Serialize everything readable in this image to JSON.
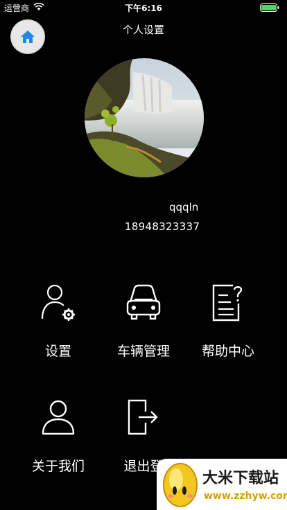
{
  "status_bar": {
    "carrier": "运营商",
    "time": "下午6:16"
  },
  "nav": {
    "title": "个人设置"
  },
  "profile": {
    "username": "qqqln",
    "phone": "18948323337"
  },
  "menu": [
    {
      "label": "设置",
      "icon": "user-settings-icon"
    },
    {
      "label": "车辆管理",
      "icon": "car-icon"
    },
    {
      "label": "帮助中心",
      "icon": "help-document-icon"
    },
    {
      "label": "关于我们",
      "icon": "user-icon"
    },
    {
      "label": "退出登",
      "icon": "logout-icon"
    }
  ],
  "watermark": {
    "title": "大米下载站",
    "url": "www.zzhyw.com"
  },
  "colors": {
    "background": "#000000",
    "foreground": "#ffffff",
    "home_icon": "#1e88e5",
    "battery": "#4cd964",
    "watermark_url": "#d6a100"
  }
}
